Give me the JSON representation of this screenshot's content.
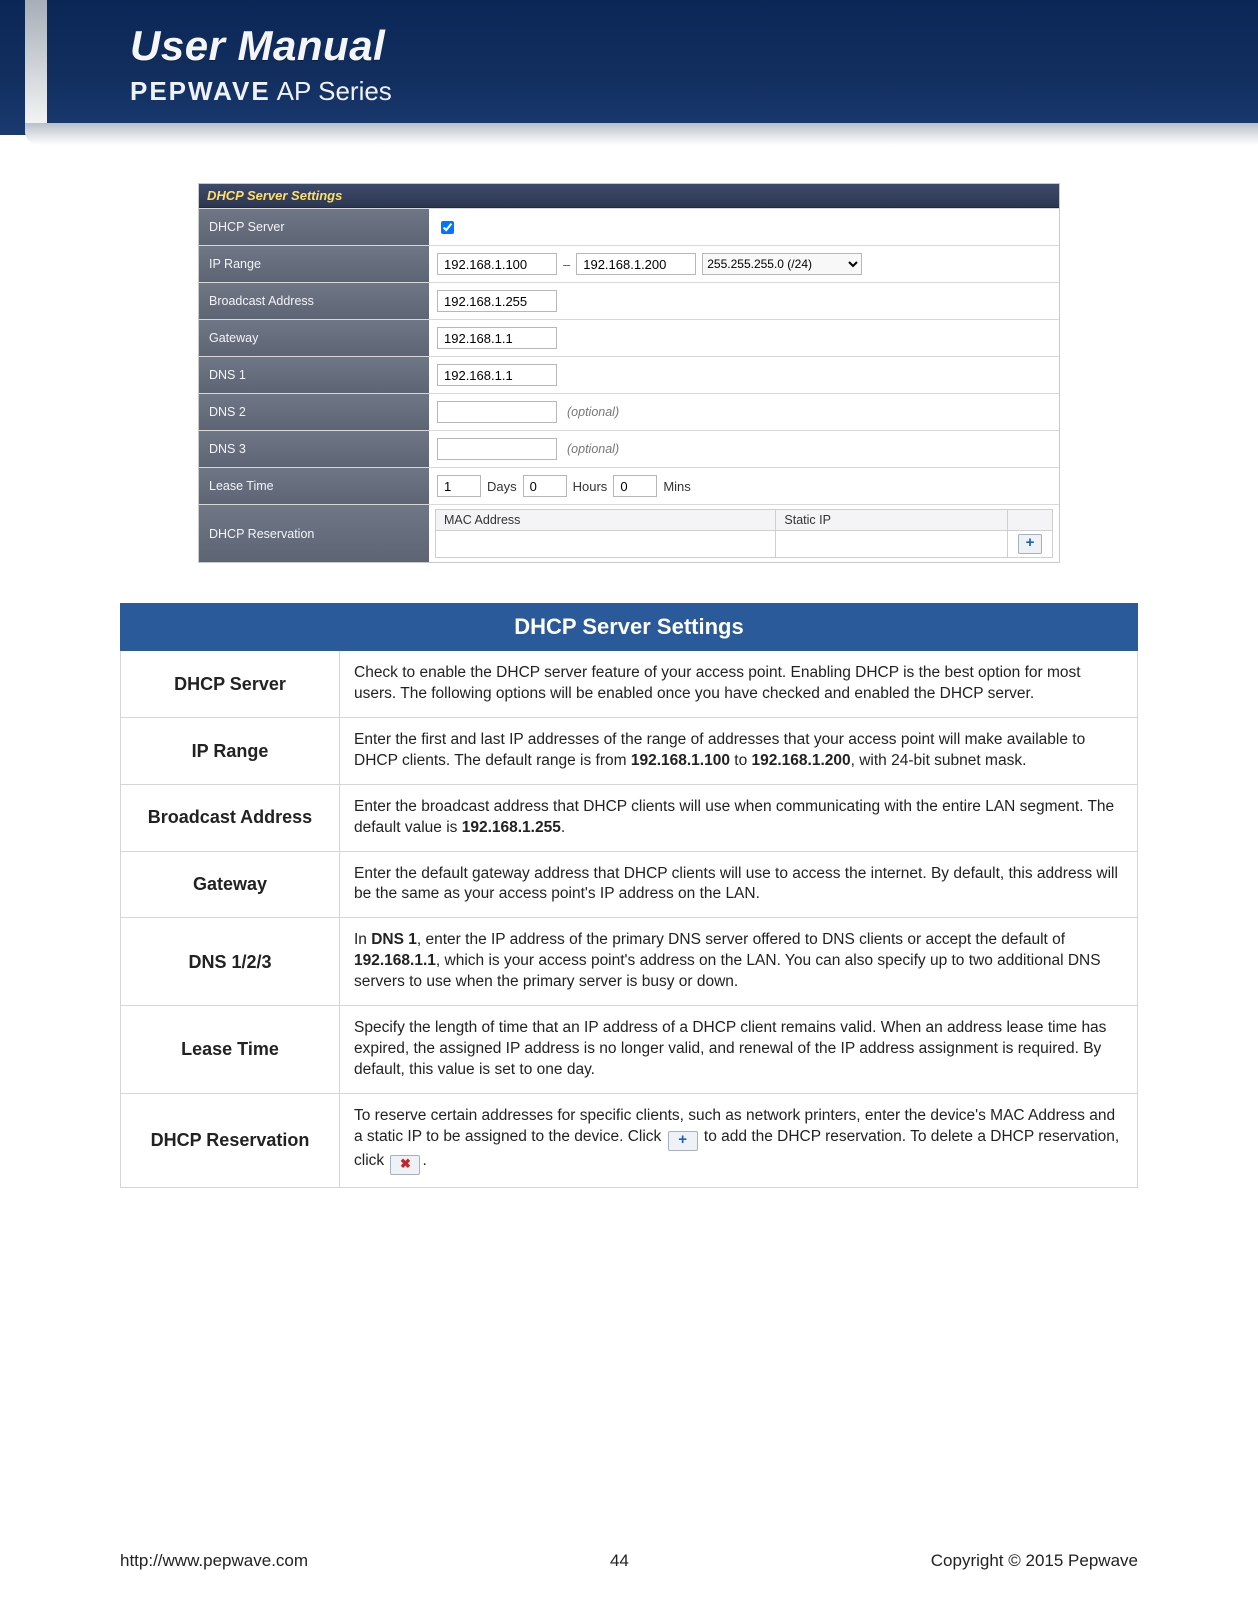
{
  "header": {
    "title": "User Manual",
    "brand": "PEPWAVE",
    "series": "AP Series"
  },
  "settings_panel": {
    "title": "DHCP Server Settings",
    "dhcp_server_label": "DHCP Server",
    "dhcp_server_checked": true,
    "ip_range_label": "IP Range",
    "ip_range_start": "192.168.1.100",
    "ip_range_sep": "–",
    "ip_range_end": "192.168.1.200",
    "subnet_mask": "255.255.255.0 (/24)",
    "broadcast_label": "Broadcast Address",
    "broadcast_value": "192.168.1.255",
    "gateway_label": "Gateway",
    "gateway_value": "192.168.1.1",
    "dns1_label": "DNS 1",
    "dns1_value": "192.168.1.1",
    "dns2_label": "DNS 2",
    "dns2_value": "",
    "dns3_label": "DNS 3",
    "dns3_value": "",
    "optional_text": "(optional)",
    "lease_label": "Lease Time",
    "lease_days": "1",
    "lease_days_unit": "Days",
    "lease_hours": "0",
    "lease_hours_unit": "Hours",
    "lease_mins": "0",
    "lease_mins_unit": "Mins",
    "reservation_label": "DHCP Reservation",
    "res_col_mac": "MAC Address",
    "res_col_ip": "Static IP"
  },
  "desc": {
    "heading": "DHCP Server Settings",
    "rows": {
      "dhcp_server_name": "DHCP Server",
      "dhcp_server_text": "Check to enable the DHCP server feature of your access point. Enabling DHCP is the best option for most users. The following options will be enabled once you have checked and enabled the DHCP server.",
      "ip_range_name": "IP Range",
      "ip_range_text_a": "Enter the first and last IP addresses of the range of addresses that your access point will make available to DHCP clients. The default range is from ",
      "ip_range_bold_a": "192.168.1.100",
      "ip_range_text_b": " to ",
      "ip_range_bold_b": "192.168.1.200",
      "ip_range_text_c": ", with 24-bit subnet mask.",
      "broadcast_name": "Broadcast Address",
      "broadcast_text_a": "Enter the broadcast address that DHCP clients will use when communicating with the entire LAN segment. The default value is ",
      "broadcast_bold": "192.168.1.255",
      "broadcast_text_b": ".",
      "gateway_name": "Gateway",
      "gateway_text": "Enter the default gateway address that DHCP clients will use to access the internet. By default, this address will be the same as your access point's IP address on the LAN.",
      "dns_name": "DNS 1/2/3",
      "dns_text_a": "In ",
      "dns_bold_a": "DNS 1",
      "dns_text_b": ", enter the IP address of the primary DNS server offered to DNS clients or accept the default of ",
      "dns_bold_b": "192.168.1.1",
      "dns_text_c": ", which is your access point's address on the LAN. You can also specify up to two additional DNS servers to use when the primary server is busy or down.",
      "lease_name": "Lease Time",
      "lease_text": "Specify the length of time that an IP address of a DHCP client remains valid. When an address lease time has expired, the assigned IP address is no longer valid, and renewal of the IP address assignment is required. By default, this value is set to one day.",
      "res_name": "DHCP Reservation",
      "res_text_a": "To reserve certain addresses for specific clients, such as network printers, enter the device's MAC Address and a static IP to be assigned to the device. Click ",
      "res_text_b": " to add the DHCP reservation. To delete a DHCP reservation, click ",
      "res_text_c": "."
    }
  },
  "footer": {
    "url": "http://www.pepwave.com",
    "page": "44",
    "copyright_a": "Copyright  ©  ",
    "copyright_year": "2015",
    "copyright_b": "  Pepwave"
  }
}
